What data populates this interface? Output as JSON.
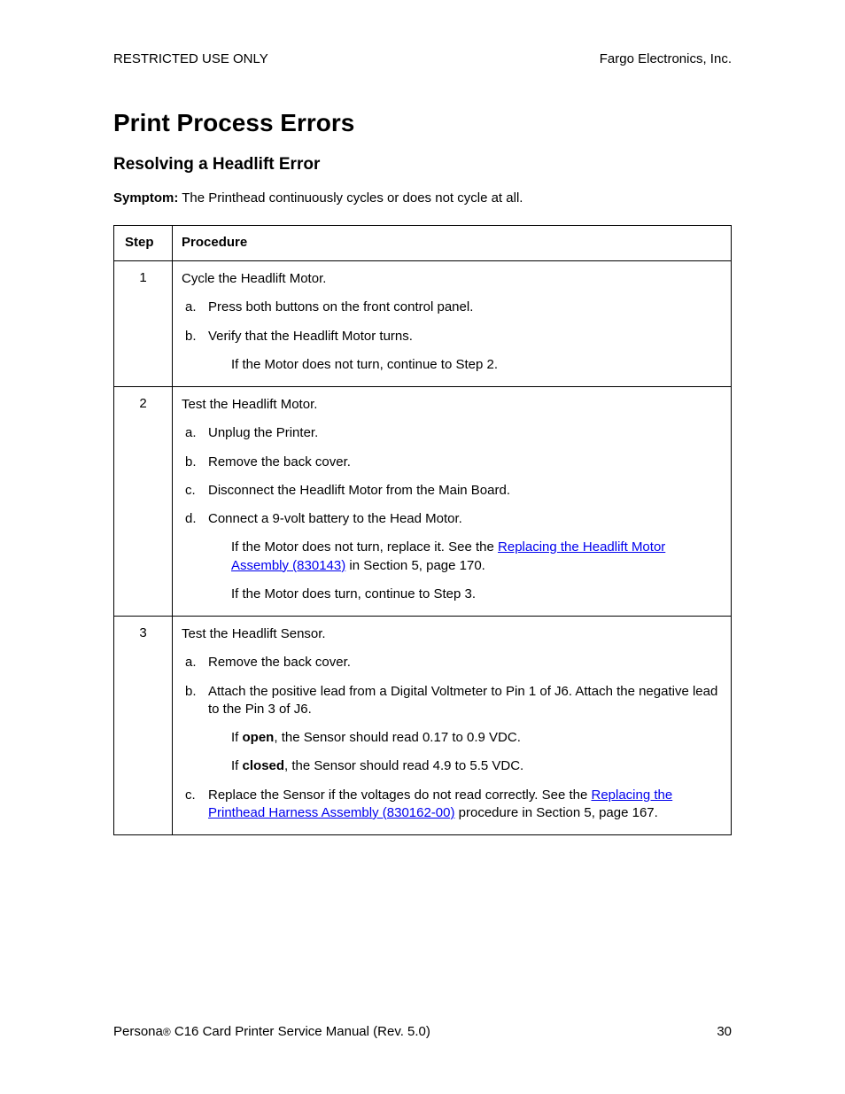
{
  "header": {
    "left": "RESTRICTED USE ONLY",
    "right": "Fargo Electronics, Inc."
  },
  "title": "Print Process Errors",
  "subtitle": "Resolving a Headlift Error",
  "symptom_label": "Symptom:",
  "symptom_text": "  The Printhead continuously cycles or does not cycle at all.",
  "table": {
    "head_step": "Step",
    "head_proc": "Procedure",
    "rows": [
      {
        "num": "1",
        "lead": "Cycle the Headlift Motor.",
        "items": [
          {
            "letter": "a.",
            "text": "Press both buttons on the front control panel."
          },
          {
            "letter": "b.",
            "text": "Verify that the Headlift Motor turns."
          }
        ],
        "notes": [
          "If the Motor does not turn, continue to Step 2."
        ]
      },
      {
        "num": "2",
        "lead": "Test the Headlift Motor.",
        "items": [
          {
            "letter": "a.",
            "text": "Unplug the Printer."
          },
          {
            "letter": "b.",
            "text": "Remove the back cover."
          },
          {
            "letter": "c.",
            "text": "Disconnect the Headlift Motor from the Main Board."
          },
          {
            "letter": "d.",
            "text": "Connect a 9-volt battery to the Head Motor."
          }
        ],
        "link_row": {
          "pre": "If the Motor does not turn, replace it. See the ",
          "link": "Replacing the Headlift Motor Assembly (830143)",
          "post": " in Section 5, page 170."
        },
        "notes": [
          "If the Motor does turn, continue to Step 3."
        ]
      },
      {
        "num": "3",
        "lead": "Test the Headlift Sensor.",
        "items": [
          {
            "letter": "a.",
            "text": "Remove the back cover."
          },
          {
            "letter": "b.",
            "text": "Attach the positive lead from a Digital Voltmeter to Pin 1 of J6. Attach the negative lead to the Pin 3 of J6."
          }
        ],
        "open_pre": "If ",
        "open_bold": "open",
        "open_post": ", the Sensor should read 0.17 to 0.9 VDC.",
        "closed_pre": "If ",
        "closed_bold": "closed",
        "closed_post": ", the Sensor should read 4.9 to 5.5 VDC.",
        "item_c": {
          "letter": "c.",
          "pre": "Replace the Sensor if the voltages do not read correctly. See the ",
          "link": "Replacing the Printhead Harness Assembly (830162-00)",
          "post": " procedure in Section 5, page 167."
        }
      }
    ]
  },
  "footer": {
    "left_pre": "Persona",
    "left_post": " C16 Card Printer Service Manual (Rev. 5.0)",
    "page": "30"
  }
}
